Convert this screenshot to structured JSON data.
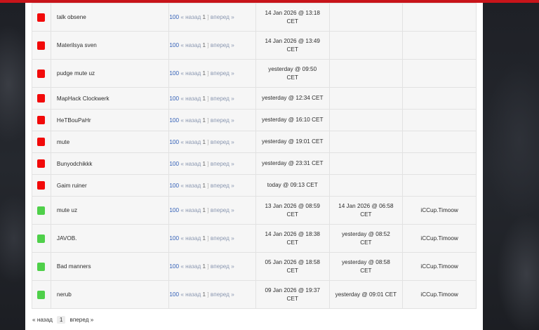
{
  "colors": {
    "red_status": "#f20a0a",
    "green_status": "#4fd04a",
    "top_bar": "#c8141a",
    "count_link": "#2f5db5"
  },
  "pager_labels": {
    "back": "« назад",
    "forward": "вперед »",
    "page": "1",
    "open": "[",
    "close": "]"
  },
  "rows": [
    {
      "status": "red",
      "reason": "talk obsene",
      "count": "100",
      "date": "14 Jan 2026 @ 13:18",
      "date_tz": "CET",
      "date2": "",
      "admin": ""
    },
    {
      "status": "red",
      "reason": "Materilsya sven",
      "count": "100",
      "date": "14 Jan 2026 @ 13:49",
      "date_tz": "CET",
      "date2": "",
      "admin": ""
    },
    {
      "status": "red",
      "reason": "pudge mute uz",
      "count": "100",
      "date": "yesterday @ 09:50",
      "date_tz": "CET",
      "date2": "",
      "admin": ""
    },
    {
      "status": "red",
      "reason": "MapHack Clockwerk",
      "count": "100",
      "date": "yesterday @ 12:34 CET",
      "date_tz": "",
      "date2": "",
      "admin": ""
    },
    {
      "status": "red",
      "reason": "HeTBouPaHr",
      "count": "100",
      "date": "yesterday @ 16:10 CET",
      "date_tz": "",
      "date2": "",
      "admin": ""
    },
    {
      "status": "red",
      "reason": "mute",
      "count": "100",
      "date": "yesterday @ 19:01 CET",
      "date_tz": "",
      "date2": "",
      "admin": ""
    },
    {
      "status": "red",
      "reason": "Bunyodchikkk",
      "count": "100",
      "date": "yesterday @ 23:31 CET",
      "date_tz": "",
      "date2": "",
      "admin": ""
    },
    {
      "status": "red",
      "reason": "Gaim ruiner",
      "count": "100",
      "date": "today @ 09:13 CET",
      "date_tz": "",
      "date2": "",
      "admin": ""
    },
    {
      "status": "green",
      "reason": "mute uz",
      "count": "100",
      "date": "13 Jan 2026 @ 08:59",
      "date_tz": "CET",
      "date2": "14 Jan 2026 @ 06:58",
      "date2_tz": "CET",
      "admin": "iCCup.Timoow"
    },
    {
      "status": "green",
      "reason": "JAVOB.",
      "count": "100",
      "date": "14 Jan 2026 @ 18:38",
      "date_tz": "CET",
      "date2": "yesterday @ 08:52",
      "date2_tz": "CET",
      "admin": "iCCup.Timoow"
    },
    {
      "status": "green",
      "reason": "Bad manners",
      "count": "100",
      "date": "05 Jan 2026 @ 18:58",
      "date_tz": "CET",
      "date2": "yesterday @ 08:58",
      "date2_tz": "CET",
      "admin": "iCCup.Timoow"
    },
    {
      "status": "green",
      "reason": "nerub",
      "count": "100",
      "date": "09 Jan 2026 @ 19:37",
      "date_tz": "CET",
      "date2": "yesterday @ 09:01 CET",
      "date2_tz": "",
      "admin": "iCCup.Timoow"
    }
  ],
  "bottom_pager": {
    "back": "« назад",
    "page": "1",
    "forward": "вперед »"
  }
}
